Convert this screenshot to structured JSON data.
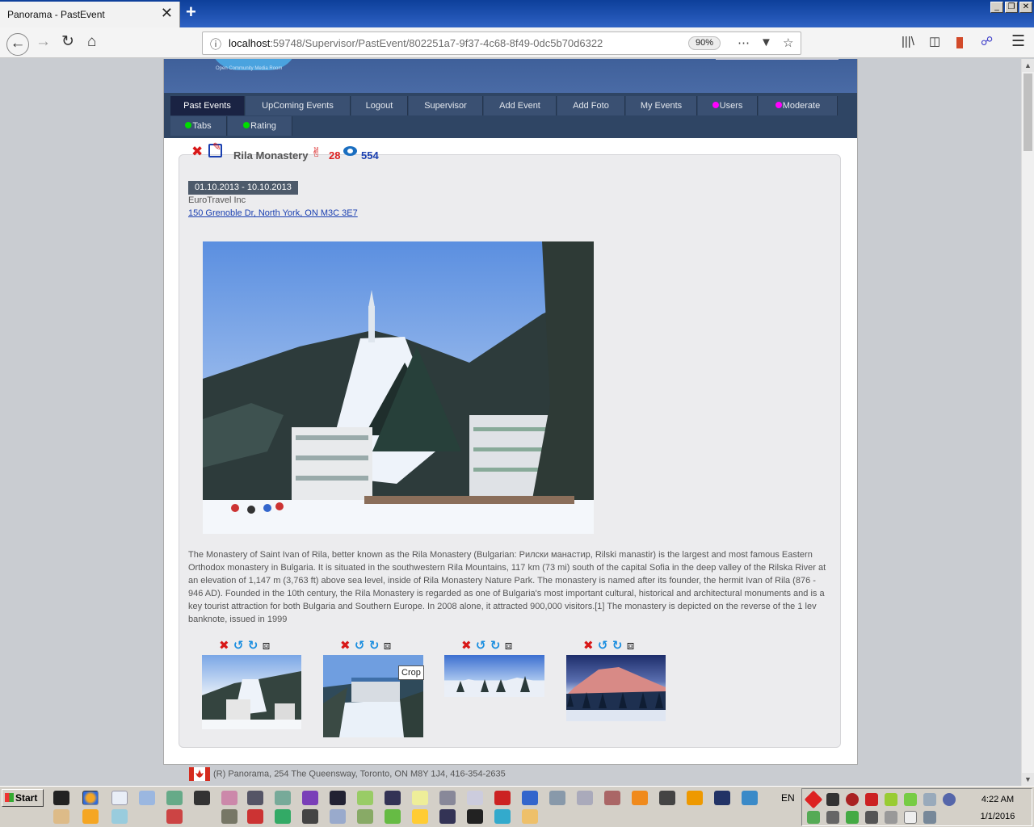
{
  "browser": {
    "tab_title": "Panorama - PastEvent",
    "tab_close": "✕",
    "new_tab": "+",
    "url_host": "localhost",
    "url_rest": ":59748/Supervisor/PastEvent/802251a7-9f37-4c68-8f49-0dc5b70d6322",
    "zoom": "90%",
    "window_buttons": [
      "_",
      "❐",
      "✕"
    ]
  },
  "logo": {
    "caption": "Open Community Media Room"
  },
  "menu": {
    "row1": [
      "Past Events",
      "UpComing Events",
      "Logout",
      "Supervisor",
      "Add Event",
      "Add Foto",
      "My Events",
      "Users",
      "Moderate"
    ],
    "row2": [
      "Tabs",
      "Rating"
    ],
    "active": "Past Events",
    "dot_colors": {
      "Users": "#ff00ff",
      "Moderate": "#ff00ff",
      "Tabs": "#00dd00",
      "Rating": "#00dd00"
    }
  },
  "event": {
    "title": "Rila Monastery",
    "likes": "28",
    "views": "554",
    "dates": "01.10.2013 - 10.10.2013",
    "organizer": "EuroTravel Inc",
    "address": "150 Grenoble Dr, North York, ON M3C 3E7",
    "description": "The Monastery of Saint Ivan of Rila, better known as the Rila Monastery (Bulgarian: Рилски манастир, Rilski manastir) is the largest and most famous Eastern Orthodox monastery in Bulgaria. It is situated in the southwestern Rila Mountains, 117 km (73 mi) south of the capital Sofia in the deep valley of the Rilska River at an elevation of 1,147 m (3,763 ft) above sea level, inside of Rila Monastery Nature Park. The monastery is named after its founder, the hermit Ivan of Rila (876 - 946 AD). Founded in the 10th century, the Rila Monastery is regarded as one of Bulgaria's most important cultural, historical and architectural monuments and is a key tourist attraction for both Bulgaria and Southern Europe. In 2008 alone, it attracted 900,000 visitors.[1] The monastery is depicted on the reverse of the 1 lev banknote, issued in 1999"
  },
  "photo_tools": {
    "delete": "✖",
    "rotate_left": "↺",
    "rotate_right": "↻",
    "crop": "⧈"
  },
  "tooltip": "Crop",
  "footer": "(R) Panorama, 254 The Queensway, Toronto, ON M8Y 1J4, 416-354-2635",
  "taskbar": {
    "start": "Start",
    "lang": "EN",
    "time": "4:22 AM",
    "date": "1/1/2016"
  }
}
